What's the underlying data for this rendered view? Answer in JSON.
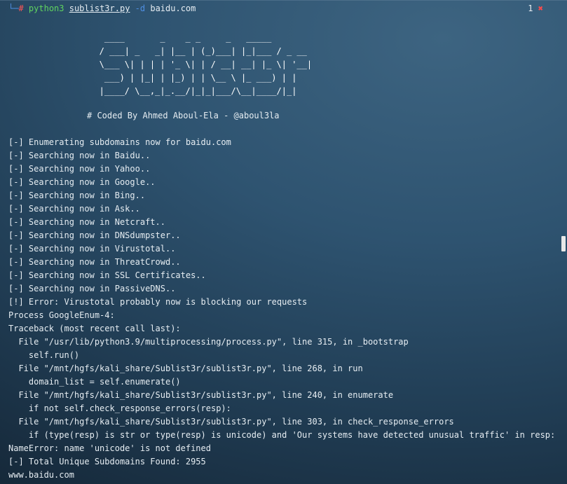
{
  "prompt": {
    "branch": "└─",
    "hash": "#",
    "cmd": "python3",
    "script": "sublist3r.py",
    "flag": "-d",
    "arg": "baidu.com"
  },
  "status": {
    "count": "1",
    "error_mark": "✖"
  },
  "banner": [
    "    ____       _    _ _     _   _____",
    "   / ___| _   _| |__ | (_)___| |_|___ / _ __",
    "   \\___ \\| | | | '_ \\| | / __| __| |_ \\| '__|",
    "    ___) | |_| | |_) | | \\__ \\ |_ ___) | |",
    "   |____/ \\__,_|_.__/|_|_|___/\\__|____/|_|"
  ],
  "coded_by": "# Coded By Ahmed Aboul-Ela - @aboul3la",
  "output": [
    "[-] Enumerating subdomains now for baidu.com",
    "[-] Searching now in Baidu..",
    "[-] Searching now in Yahoo..",
    "[-] Searching now in Google..",
    "[-] Searching now in Bing..",
    "[-] Searching now in Ask..",
    "[-] Searching now in Netcraft..",
    "[-] Searching now in DNSdumpster..",
    "[-] Searching now in Virustotal..",
    "[-] Searching now in ThreatCrowd..",
    "[-] Searching now in SSL Certificates..",
    "[-] Searching now in PassiveDNS..",
    "[!] Error: Virustotal probably now is blocking our requests",
    "Process GoogleEnum-4:",
    "Traceback (most recent call last):",
    "  File \"/usr/lib/python3.9/multiprocessing/process.py\", line 315, in _bootstrap",
    "    self.run()",
    "  File \"/mnt/hgfs/kali_share/Sublist3r/sublist3r.py\", line 268, in run",
    "    domain_list = self.enumerate()",
    "  File \"/mnt/hgfs/kali_share/Sublist3r/sublist3r.py\", line 240, in enumerate",
    "    if not self.check_response_errors(resp):",
    "  File \"/mnt/hgfs/kali_share/Sublist3r/sublist3r.py\", line 303, in check_response_errors",
    "    if (type(resp) is str or type(resp) is unicode) and 'Our systems have detected unusual traffic' in resp:",
    "NameError: name 'unicode' is not defined",
    "[-] Total Unique Subdomains Found: 2955",
    "www.baidu.com"
  ],
  "colors": {
    "prompt_blue": "#4f8fe3",
    "prompt_hash": "#ff5555",
    "cmd_green": "#5fd35f"
  }
}
